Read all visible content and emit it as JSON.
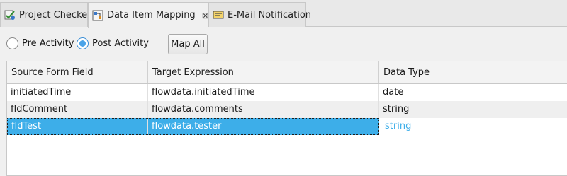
{
  "tabs": [
    {
      "label": "Project Checker",
      "icon": "project-checker-icon",
      "active": false
    },
    {
      "label": "Data Item Mapping",
      "icon": "data-mapping-icon",
      "active": true,
      "close": "⊠"
    },
    {
      "label": "E-Mail Notification",
      "icon": "email-notification-icon",
      "active": false
    }
  ],
  "options": {
    "pre_activity_label": "Pre Activity",
    "post_activity_label": "Post Activity",
    "selected": "Post Activity",
    "map_all_label": "Map All"
  },
  "table": {
    "columns": [
      "Source Form Field",
      "Target Expression",
      "Data Type"
    ],
    "rows": [
      [
        "initiatedTime",
        "flowdata.initiatedTime",
        "date"
      ],
      [
        "fldComment",
        "flowdata.comments",
        "string"
      ],
      [
        "fldTest",
        "flowdata.tester",
        "string"
      ]
    ],
    "selected_row": 2
  },
  "colors": {
    "selection": "#3daee9",
    "radio_accent": "#4aa3e8"
  }
}
